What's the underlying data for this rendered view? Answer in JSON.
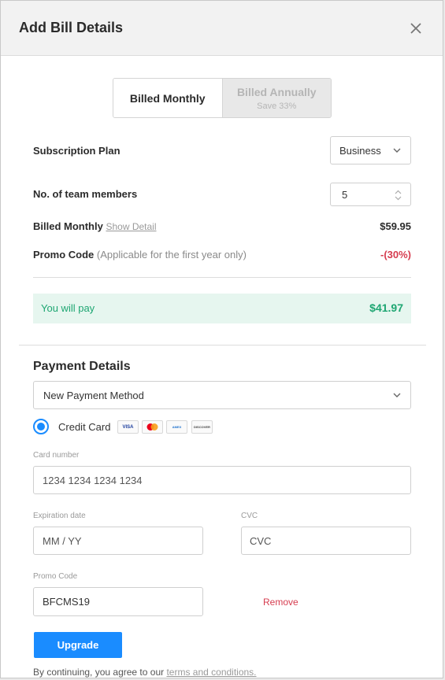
{
  "dialog": {
    "title": "Add Bill Details",
    "close_icon": "close-icon"
  },
  "billing_toggle": {
    "monthly_label": "Billed Monthly",
    "annually_label": "Billed Annually",
    "annually_subtext": "Save 33%",
    "selected": "monthly"
  },
  "summary": {
    "plan_label": "Subscription Plan",
    "plan_value": "Business",
    "members_label": "No. of team members",
    "members_value": "5",
    "billed_label": "Billed Monthly",
    "show_detail_link": "Show Detail",
    "billed_amount": "$59.95",
    "promo_label": "Promo Code",
    "promo_note": "(Applicable for the first year only)",
    "promo_discount": "-(30%)",
    "you_pay_label": "You will pay",
    "you_pay_amount": "$41.97"
  },
  "payment": {
    "section_title": "Payment Details",
    "method_value": "New Payment Method",
    "credit_card_label": "Credit Card",
    "card_brands": [
      "VISA",
      "mastercard",
      "AMEX",
      "DISCOVER"
    ],
    "card_number_label": "Card number",
    "card_number_placeholder": "1234 1234 1234 1234",
    "expiry_label": "Expiration date",
    "expiry_placeholder": "MM / YY",
    "cvc_label": "CVC",
    "cvc_placeholder": "CVC",
    "promo_code_label": "Promo Code",
    "promo_code_value": "BFCMS19",
    "remove_label": "Remove"
  },
  "actions": {
    "upgrade_label": "Upgrade",
    "footer_text": "By continuing, you agree to our ",
    "terms_link": "terms and conditions."
  },
  "colors": {
    "primary": "#1a8cff",
    "success": "#1ea672",
    "danger": "#d63c4f"
  }
}
